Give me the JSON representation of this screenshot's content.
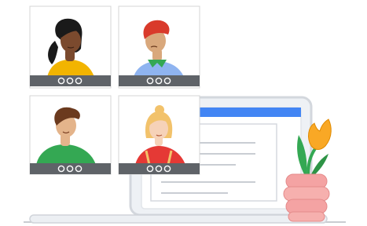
{
  "participants": [
    {
      "role": "video-tile",
      "skin": "#7b4a2e",
      "hair": "#1a1a1a",
      "shirt": "#f2b400"
    },
    {
      "role": "video-tile",
      "skin": "#d9a87c",
      "hair": "#d93a2b",
      "shirt": "#8fb4f0",
      "accessory": "#34a853"
    },
    {
      "role": "video-tile",
      "skin": "#e4b48b",
      "hair": "#6b3a1e",
      "shirt": "#34a853"
    },
    {
      "role": "video-tile",
      "skin": "#f6d2b8",
      "hair": "#f2c26b",
      "shirt": "#e53935"
    }
  ],
  "controls_per_tile": 3,
  "colors": {
    "control_bar": "#5f6368",
    "laptop_frame": "#d0d5dc",
    "laptop_accent": "#4285f4",
    "vase": "#f4a3a3",
    "flower": "#f9a825",
    "leaf": "#34a853"
  }
}
